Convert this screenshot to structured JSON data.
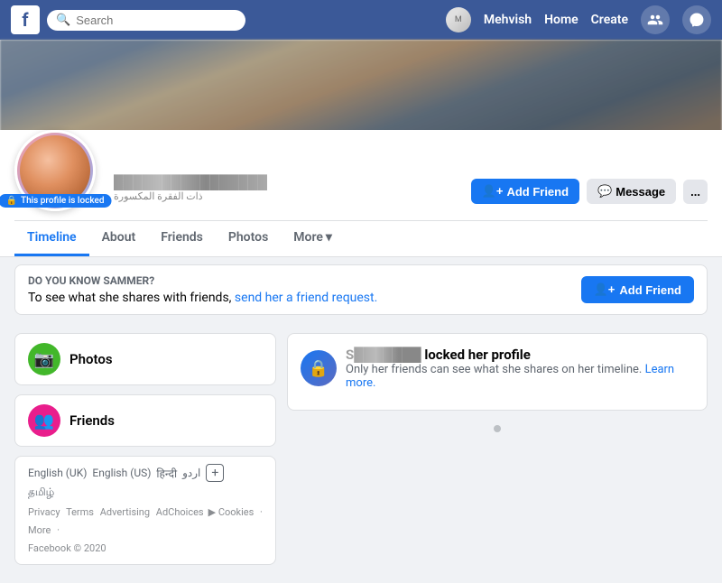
{
  "nav": {
    "logo": "f",
    "search_placeholder": "Search",
    "username": "Mehvish",
    "home_label": "Home",
    "create_label": "Create"
  },
  "profile": {
    "locked_badge": "This profile is locked",
    "add_friend_label": "Add Friend",
    "message_label": "Message",
    "more_actions_label": "...",
    "subtitle": "ذات الفقرة المكسورة"
  },
  "profile_nav": {
    "tabs": [
      {
        "id": "timeline",
        "label": "Timeline",
        "active": true
      },
      {
        "id": "about",
        "label": "About",
        "active": false
      },
      {
        "id": "friends",
        "label": "Friends",
        "active": false
      },
      {
        "id": "photos",
        "label": "Photos",
        "active": false
      },
      {
        "id": "more",
        "label": "More",
        "active": false
      }
    ]
  },
  "know_banner": {
    "title": "DO YOU KNOW SAMMER?",
    "text": "To see what she shares with friends,",
    "link_text": "send her a friend request.",
    "add_friend_label": "Add Friend"
  },
  "sidebar": {
    "photos_label": "Photos",
    "friends_label": "Friends",
    "languages": [
      "English (UK)",
      "English (US)",
      "हिन्दी",
      "اردو",
      "தமிழ்"
    ],
    "footer": {
      "privacy": "Privacy",
      "terms": "Terms",
      "advertising": "Advertising",
      "adchoices": "AdChoices",
      "cookies": "Cookies",
      "more": "More",
      "copyright": "Facebook © 2020"
    }
  },
  "locked_post": {
    "name_blurred": "S███████",
    "action": "locked her profile",
    "description": "Only her friends can see what she shares on her timeline.",
    "learn_more": "Learn more."
  }
}
